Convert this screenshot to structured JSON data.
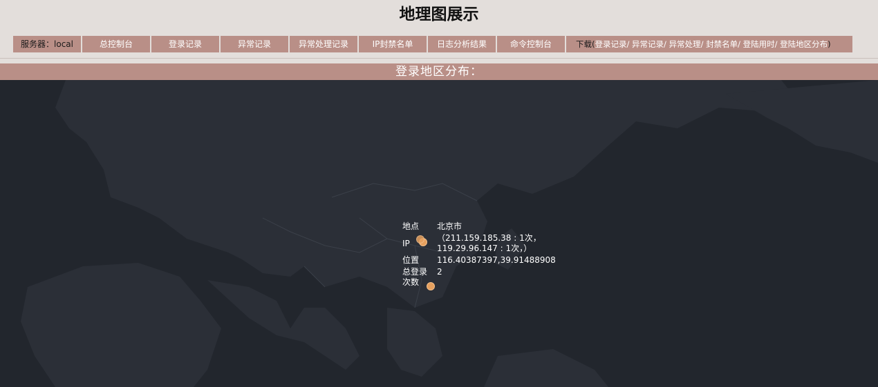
{
  "page": {
    "title": "地理图展示"
  },
  "nav": {
    "server_label": "服务器：local",
    "items": [
      "总控制台",
      "登录记录",
      "异常记录",
      "异常处理记录",
      "IP封禁名单",
      "日志分析结果",
      "命令控制台"
    ],
    "download_prefix": "下载(",
    "download_links": [
      "登录记录",
      "异常记录",
      "异常处理",
      "封禁名单",
      "登陆用时",
      "登陆地区分布"
    ],
    "download_suffix": ")",
    "separator": "/"
  },
  "section": {
    "title": "登录地区分布："
  },
  "tooltip": {
    "location_key": "地点",
    "location_value": "北京市",
    "ip_key": "IP",
    "ip_value": "（211.159.185.38 : 1次，\n119.29.96.147 : 1次，）",
    "position_key": "位置",
    "position_value": "116.40387397,39.91488908",
    "total_key_line1": "总登录",
    "total_key_line2": "次数",
    "total_value": "2"
  },
  "colors": {
    "accent": "#b98f87",
    "map_background": "#22262d",
    "land": "#2c3038",
    "marker": "#e6a05e"
  },
  "icons": [
    "location-marker-icon"
  ]
}
